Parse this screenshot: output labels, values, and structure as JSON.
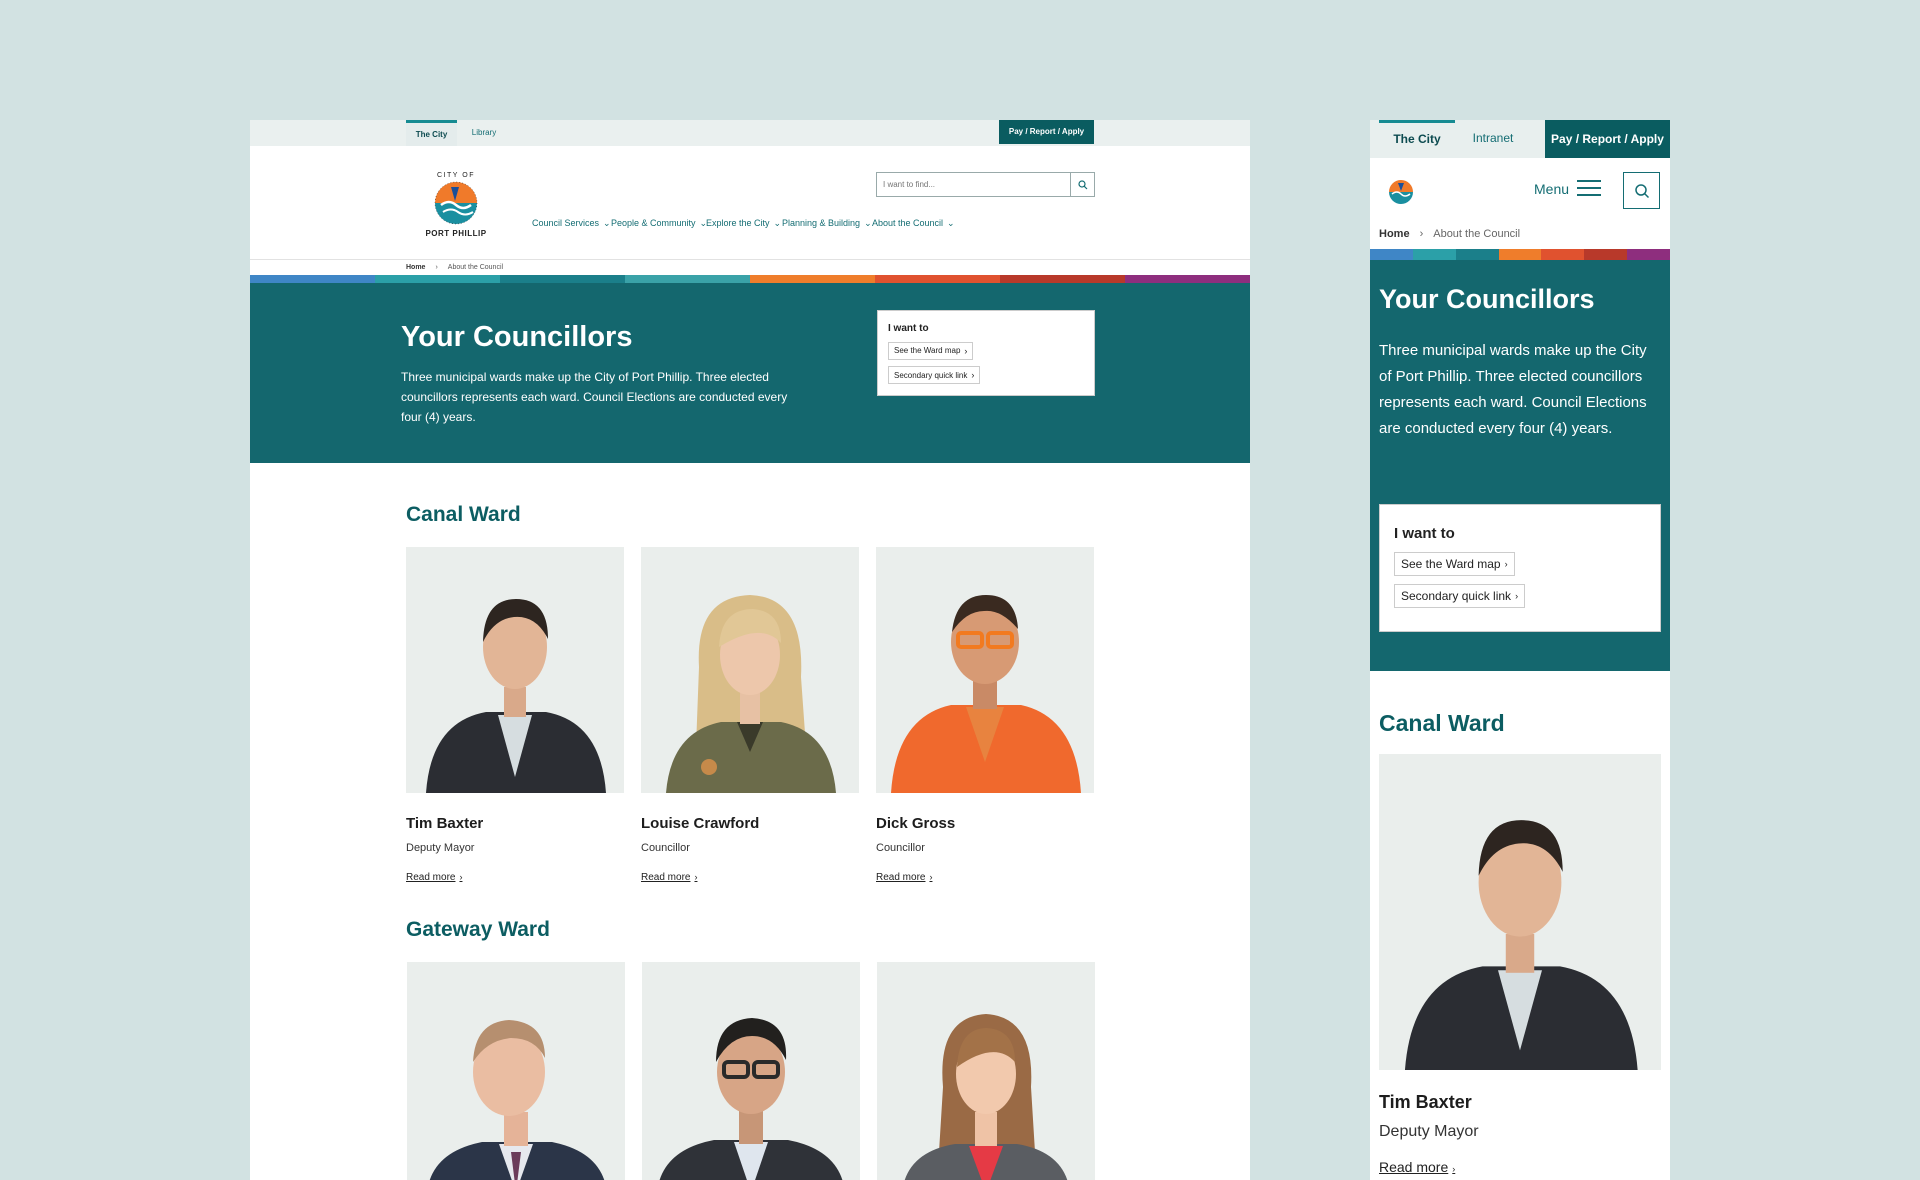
{
  "utility": {
    "tab_city": "The City",
    "tab_library": "Library",
    "pay": "Pay / Report / Apply"
  },
  "logo": {
    "label": "CITY OF PORT PHILLIP"
  },
  "search": {
    "placeholder": "I want to find..."
  },
  "nav": [
    "Council Services",
    "People & Community",
    "Explore the City",
    "Planning & Building",
    "About the Council"
  ],
  "breadcrumb": {
    "home": "Home",
    "current": "About the Council"
  },
  "hero": {
    "title": "Your Councillors",
    "text": "Three municipal wards make up the City of Port Phillip. Three elected councillors represents each ward. Council Elections are conducted every four (4) years."
  },
  "iwant": {
    "title": "I want to",
    "links": [
      "See the Ward map",
      "Secondary quick link"
    ]
  },
  "wards": [
    {
      "name": "Canal Ward",
      "councillors": [
        {
          "name": "Tim Baxter",
          "role": "Deputy Mayor",
          "read": "Read more"
        },
        {
          "name": "Louise Crawford",
          "role": "Councillor",
          "read": "Read more"
        },
        {
          "name": "Dick Gross",
          "role": "Councillor",
          "read": "Read more"
        }
      ]
    },
    {
      "name": "Gateway Ward"
    }
  ],
  "mobile": {
    "tab_city": "The City",
    "tab_intranet": "Intranet",
    "pay": "Pay / Report / Apply",
    "menu": "Menu"
  },
  "colors": {
    "teal_dark": "#14676e",
    "teal_brand": "#0a5c60",
    "ward_heading": "#0c5d62",
    "background": "#d2e2e2"
  }
}
